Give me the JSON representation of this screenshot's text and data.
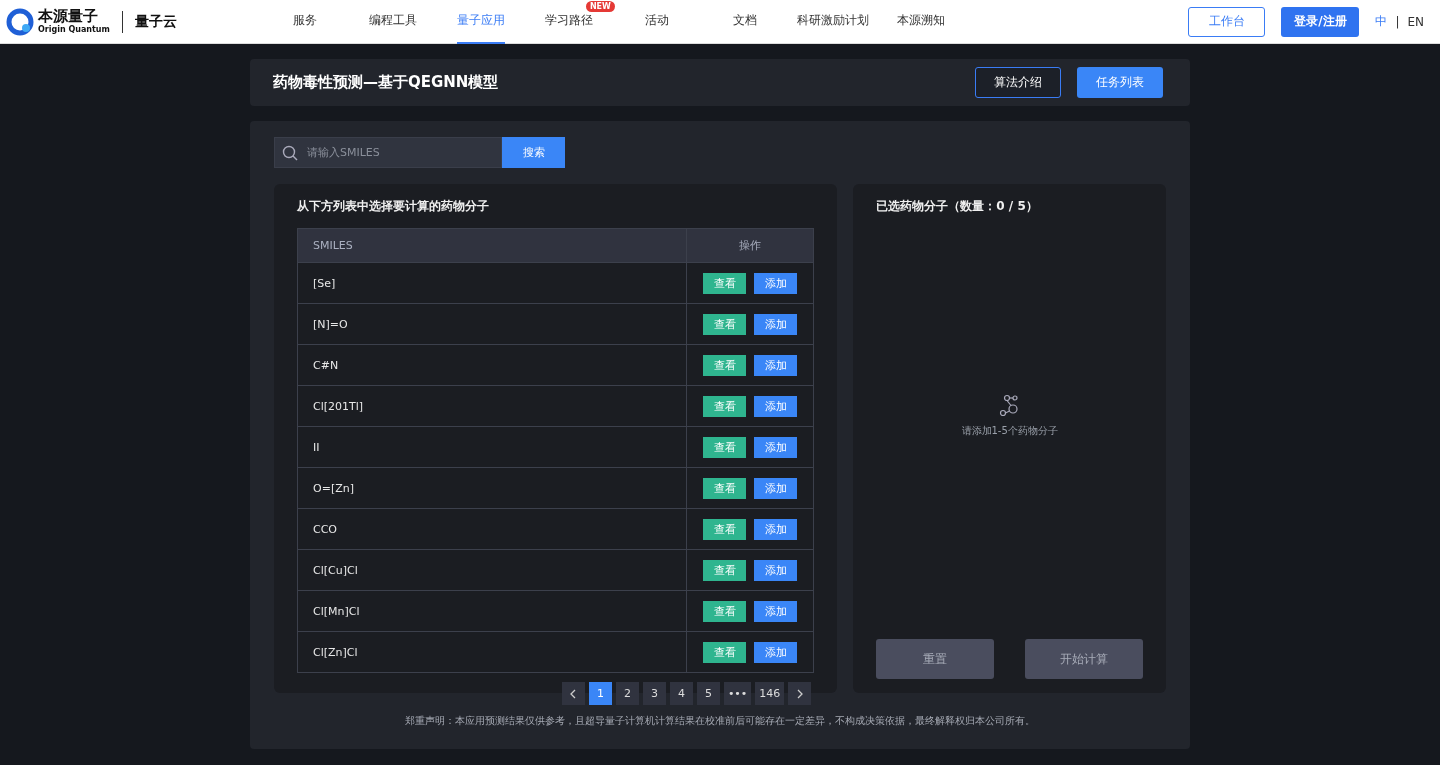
{
  "header": {
    "logo": {
      "name": "本源量子",
      "subtitle": "Origin Quantum"
    },
    "product": "量子云",
    "nav": [
      {
        "label": "服务",
        "selected": false
      },
      {
        "label": "编程工具",
        "selected": false
      },
      {
        "label": "量子应用",
        "selected": true
      },
      {
        "label": "学习路径",
        "selected": false,
        "badge": "NEW"
      },
      {
        "label": "活动",
        "selected": false
      },
      {
        "label": "文档",
        "selected": false
      },
      {
        "label": "科研激励计划",
        "selected": false
      },
      {
        "label": "本源溯知",
        "selected": false
      }
    ],
    "workbench": "工作台",
    "login": "登录/注册",
    "languages": [
      {
        "label": "中",
        "selected": true
      },
      {
        "label": "EN",
        "selected": false
      }
    ],
    "language_separator": "|"
  },
  "title_bar": {
    "title": "药物毒性预测—基于QEGNN模型",
    "buttons": [
      {
        "label": "算法介绍",
        "kind": "outline"
      },
      {
        "label": "任务列表",
        "kind": "primary"
      }
    ]
  },
  "search": {
    "placeholder": "请输入SMILES",
    "button": "搜索"
  },
  "molecule_list": {
    "title": "从下方列表中选择要计算的药物分子",
    "columns": [
      "SMILES",
      "操作"
    ],
    "rows": [
      {
        "smiles": "[Se]",
        "view": "查看",
        "add": "添加"
      },
      {
        "smiles": "[N]=O",
        "view": "查看",
        "add": "添加"
      },
      {
        "smiles": "C#N",
        "view": "查看",
        "add": "添加"
      },
      {
        "smiles": "Cl[201Tl]",
        "view": "查看",
        "add": "添加"
      },
      {
        "smiles": "II",
        "view": "查看",
        "add": "添加"
      },
      {
        "smiles": "O=[Zn]",
        "view": "查看",
        "add": "添加"
      },
      {
        "smiles": "CCO",
        "view": "查看",
        "add": "添加"
      },
      {
        "smiles": "Cl[Cu]Cl",
        "view": "查看",
        "add": "添加"
      },
      {
        "smiles": "Cl[Mn]Cl",
        "view": "查看",
        "add": "添加"
      },
      {
        "smiles": "Cl[Zn]Cl",
        "view": "查看",
        "add": "添加"
      }
    ],
    "pagination": [
      {
        "label": "1",
        "selected": true
      },
      {
        "label": "2",
        "selected": false
      },
      {
        "label": "3",
        "selected": false
      },
      {
        "label": "4",
        "selected": false
      },
      {
        "label": "5",
        "selected": false
      },
      {
        "label": "•••",
        "selected": false
      },
      {
        "label": "146",
        "selected": false
      }
    ]
  },
  "selected_panel": {
    "title": "已选药物分子（数量：0 / 5）",
    "empty_text": "请添加1-5个药物分子",
    "buttons": [
      "重置",
      "开始计算"
    ]
  },
  "disclaimer": "郑重声明：本应用预测结果仅供参考，且超导量子计算机计算结果在校准前后可能存在一定差异，不构成决策依据，最终解释权归本公司所有。"
}
